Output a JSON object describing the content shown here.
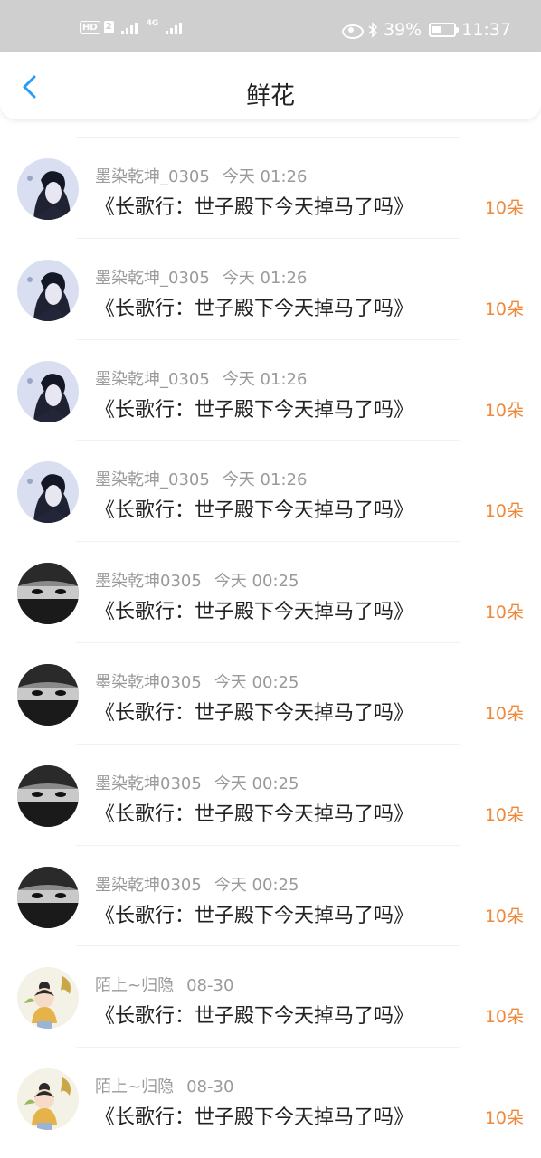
{
  "status_bar": {
    "hd": "HD",
    "sim": "2",
    "network": "4G",
    "battery": "39%",
    "battery_level": 0.39,
    "time": "11:37"
  },
  "nav": {
    "title": "鲜花",
    "back_icon": "chevron-left-icon"
  },
  "colors": {
    "accent": "#2b9af3",
    "count": "#f0883a",
    "status_bar_bg": "#cfcfcf"
  },
  "items": [
    {
      "username": "墨染乾坤_0305",
      "time": "今天 01:26",
      "title": "《长歌行：世子殿下今天掉马了吗》",
      "count": "10朵",
      "avatar": "avatar-blue-portrait"
    },
    {
      "username": "墨染乾坤_0305",
      "time": "今天 01:26",
      "title": "《长歌行：世子殿下今天掉马了吗》",
      "count": "10朵",
      "avatar": "avatar-blue-portrait"
    },
    {
      "username": "墨染乾坤_0305",
      "time": "今天 01:26",
      "title": "《长歌行：世子殿下今天掉马了吗》",
      "count": "10朵",
      "avatar": "avatar-blue-portrait"
    },
    {
      "username": "墨染乾坤_0305",
      "time": "今天 01:26",
      "title": "《长歌行：世子殿下今天掉马了吗》",
      "count": "10朵",
      "avatar": "avatar-blue-portrait"
    },
    {
      "username": "墨染乾坤0305",
      "time": "今天 00:25",
      "title": "《长歌行：世子殿下今天掉马了吗》",
      "count": "10朵",
      "avatar": "avatar-masked-face"
    },
    {
      "username": "墨染乾坤0305",
      "time": "今天 00:25",
      "title": "《长歌行：世子殿下今天掉马了吗》",
      "count": "10朵",
      "avatar": "avatar-masked-face"
    },
    {
      "username": "墨染乾坤0305",
      "time": "今天 00:25",
      "title": "《长歌行：世子殿下今天掉马了吗》",
      "count": "10朵",
      "avatar": "avatar-masked-face"
    },
    {
      "username": "墨染乾坤0305",
      "time": "今天 00:25",
      "title": "《长歌行：世子殿下今天掉马了吗》",
      "count": "10朵",
      "avatar": "avatar-masked-face"
    },
    {
      "username": "陌上~归隐",
      "time": "08-30",
      "title": "《长歌行：世子殿下今天掉马了吗》",
      "count": "10朵",
      "avatar": "avatar-cartoon-girl"
    },
    {
      "username": "陌上~归隐",
      "time": "08-30",
      "title": "《长歌行：世子殿下今天掉马了吗》",
      "count": "10朵",
      "avatar": "avatar-cartoon-girl"
    }
  ]
}
